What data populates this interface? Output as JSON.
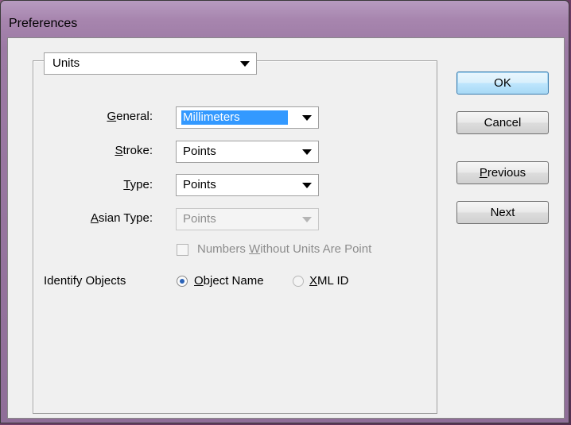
{
  "window": {
    "title": "Preferences"
  },
  "panel_select": {
    "value": "Units"
  },
  "rows": [
    {
      "label_mn": "G",
      "label_rest": "eneral:",
      "value": "Millimeters",
      "disabled": false
    },
    {
      "label_mn": "S",
      "label_rest": "troke:",
      "value": "Points",
      "disabled": false
    },
    {
      "label_mn": "T",
      "label_rest": "ype:",
      "value": "Points",
      "disabled": false
    },
    {
      "label_mn": "A",
      "label_rest": "sian Type:",
      "value": "Points",
      "disabled": true
    }
  ],
  "checkbox": {
    "label_pre": "Numbers ",
    "label_mn": "W",
    "label_post": "ithout Units Are Point",
    "checked": false,
    "disabled": true
  },
  "identify": {
    "label": "Identify Objects",
    "options": [
      {
        "mn": "O",
        "rest": "bject Name",
        "checked": true
      },
      {
        "mn": "X",
        "rest": "ML ID",
        "checked": false
      }
    ]
  },
  "buttons": {
    "ok": "OK",
    "cancel": "Cancel",
    "previous_mn": "P",
    "previous_rest": "revious",
    "next": "Next"
  }
}
